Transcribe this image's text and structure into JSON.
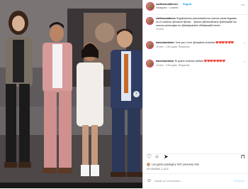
{
  "post": {
    "username": "carlitoscalderon",
    "follow_label": "Seguir",
    "subtitle": "Instagram · Londres",
    "more_icon": "more-options-icon"
  },
  "caption": {
    "username": "carlitoscalderon",
    "text": "Orgullosísimo presentarles los nuevos caras llegadas en el universo @marvel @hule... @seon @leescifmario @ahmad66 los nuevos personajes en @blackpanther #WakandaForever",
    "time": "15 sem."
  },
  "comments": [
    {
      "username": "hancelambinio",
      "text": "I love you I love @espiento America",
      "hearts": "❤️❤️❤️❤️❤️❤️",
      "time": "15 sem.",
      "likes": "1 Me gusta",
      "reply": "Responder"
    },
    {
      "username": "hancelambinio",
      "text": "Te quiero muchos carlitos",
      "hearts": "❤️❤️❤️❤️❤️❤️❤️",
      "time": "15 sem.",
      "likes": "3 Me gusta",
      "reply": "Responder"
    }
  ],
  "actions": {
    "like_icon": "heart-icon",
    "comment_icon": "comment-icon",
    "share_icon": "share-icon",
    "save_icon": "bookmark-icon"
  },
  "likes_text": "Les gusta a juliangil y 1427 personas más",
  "date": "NOVIEMBRE 3, 2022",
  "add_comment": {
    "placeholder": "Añade un comentario...",
    "publish": "Publicar"
  },
  "colors": {
    "link": "#0095f6",
    "publish_disabled": "#b3dbff",
    "muted": "#737373"
  }
}
